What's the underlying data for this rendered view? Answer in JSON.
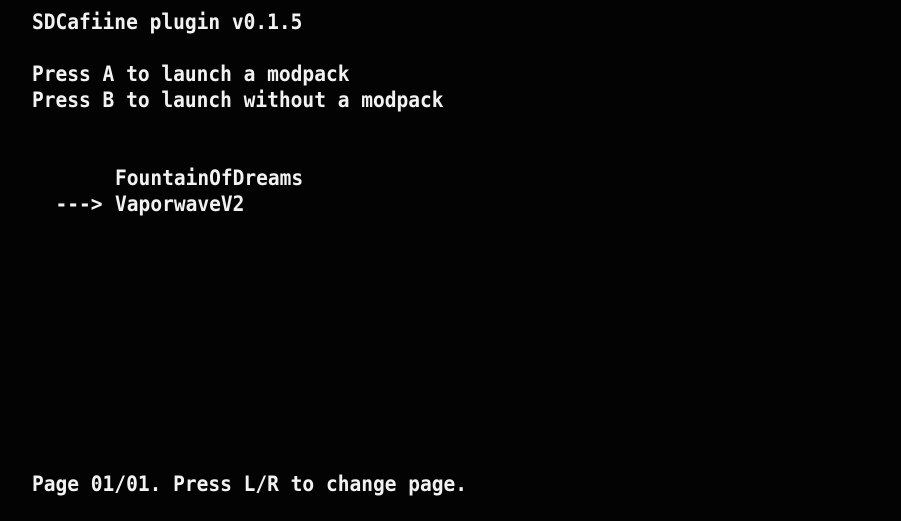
{
  "header": {
    "title": "SDCafiine plugin v0.1.5"
  },
  "instructions": {
    "launch_with": "Press A to launch a modpack",
    "launch_without": "Press B to launch without a modpack"
  },
  "modpacks": {
    "cursor": "--->",
    "items": [
      {
        "name": "FountainOfDreams",
        "selected": false
      },
      {
        "name": "VaporwaveV2",
        "selected": true
      }
    ]
  },
  "footer": {
    "page_info": "Page 01/01. Press L/R to change page."
  },
  "colors": {
    "background": "#030303",
    "text": "#f2f2f2"
  }
}
